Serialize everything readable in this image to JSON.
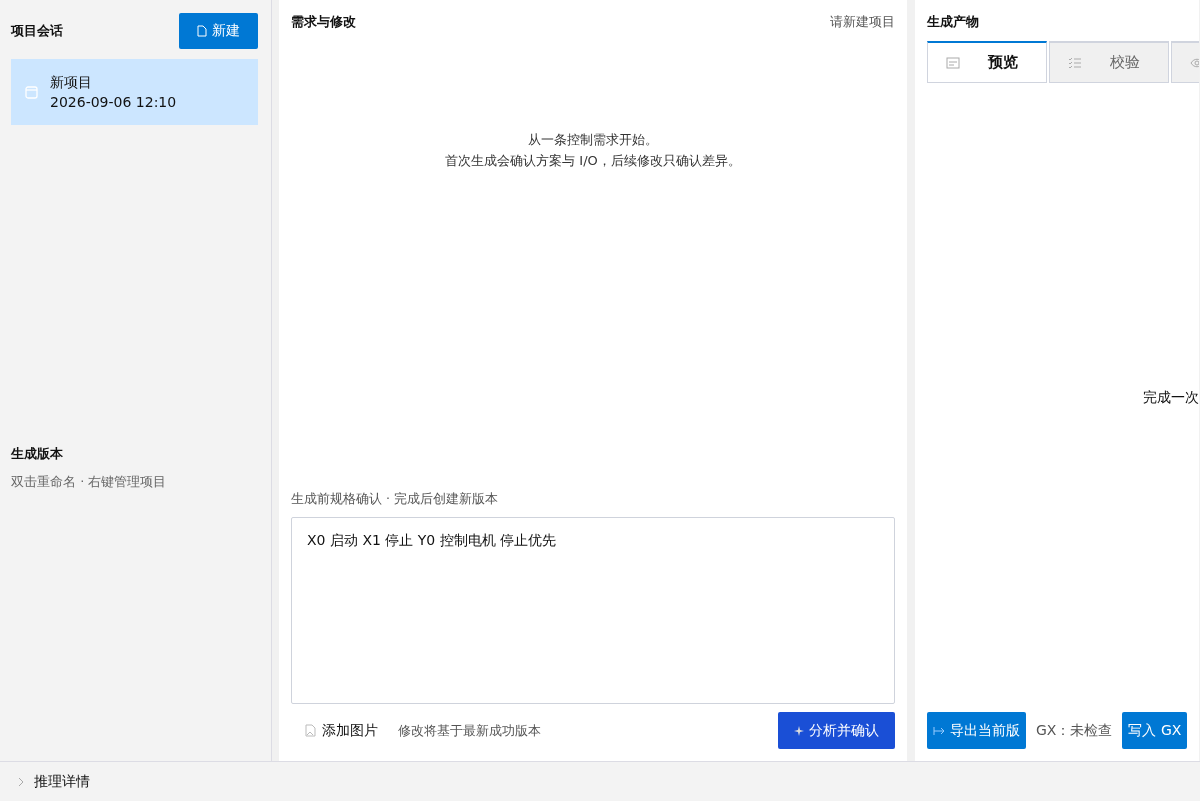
{
  "sessions": {
    "title": "项目会话",
    "new_button": "新建",
    "items": [
      {
        "name": "新项目",
        "time": "2026-09-06 12:10",
        "selected": true
      }
    ]
  },
  "versions": {
    "title": "生成版本",
    "hint": "双击重命名 · 右键管理项目"
  },
  "editor": {
    "title": "需求与修改",
    "header_action": "请新建项目",
    "empty_lines": [
      "从一条控制需求开始。",
      "首次生成会确认方案与 I/O，后续修改只确认差异。"
    ],
    "input_label": "生成前规格确认 · 完成后创建新版本",
    "input_value": "X0 启动 X1 停止 Y0 控制电机 停止优先",
    "add_image": "添加图片",
    "base_hint": "修改将基于最新成功版本",
    "submit": "分析并确认"
  },
  "output": {
    "title": "生成产物",
    "tabs": [
      {
        "label": "预览",
        "kind": "preview",
        "selected": true
      },
      {
        "label": "校验",
        "kind": "check",
        "selected": false
      },
      {
        "kind": "view",
        "selected": false
      }
    ],
    "empty_text": "完成一次",
    "export_button": "导出当前版",
    "gx_status": "GX：未检查",
    "write_button": "写入 GX"
  },
  "footer": {
    "label": "推理详情",
    "expanded": false
  }
}
